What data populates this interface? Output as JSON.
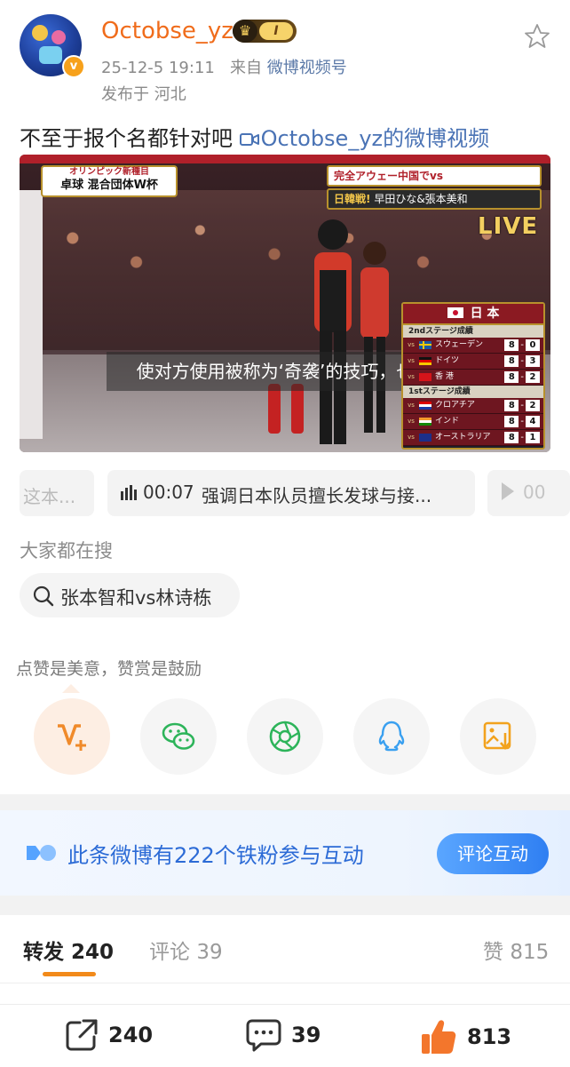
{
  "user": {
    "name": "Octobse_yz",
    "level": "I",
    "verified_mark": "v"
  },
  "post": {
    "date": "25-12-5 19:11",
    "from_label": "来自",
    "source": "微博视频号",
    "location": "发布于 河北",
    "text": "不至于报个名都针对吧 ",
    "video_link": "Octobse_yz的微博视频"
  },
  "video": {
    "tag_left_top": "オリンピック新種目",
    "tag_left_bottom": "卓球 混合団体W杯",
    "tag_right_top": "完全アウェー中国でvs",
    "tag_right_bottom_a": "日韓戦!",
    "tag_right_bottom_b": "早田ひな&張本美和",
    "live": "LIVE",
    "subtitle": "使对方使用被称为‘奇袭’的技巧，也",
    "scoreboard": {
      "team": "日 本",
      "stage2": "2ndステージ成績",
      "stage1": "1stステージ成績",
      "vs": "vs",
      "rows2": [
        {
          "name": "スウェーデン",
          "a": "8",
          "b": "0",
          "flag": "sweden"
        },
        {
          "name": "ドイツ",
          "a": "8",
          "b": "3",
          "flag": "germany"
        },
        {
          "name": "香 港",
          "a": "8",
          "b": "2",
          "flag": "hongkong"
        }
      ],
      "rows1": [
        {
          "name": "クロアチア",
          "a": "8",
          "b": "2",
          "flag": "croatia"
        },
        {
          "name": "インド",
          "a": "8",
          "b": "4",
          "flag": "india"
        },
        {
          "name": "オーストラリア",
          "a": "8",
          "b": "1",
          "flag": "australia"
        }
      ]
    }
  },
  "chapters": {
    "prev": "这本...",
    "current_time": "00:07",
    "current_title": "强调日本队员擅长发球与接...",
    "next_time": "00"
  },
  "search": {
    "title": "大家都在搜",
    "query": "张本智和vs林诗栋"
  },
  "reward": {
    "text": "点赞是美意，赞赏是鼓励",
    "buttons": [
      "reward-v-plus-icon",
      "wechat-icon",
      "moments-icon",
      "qq-icon",
      "save-image-icon"
    ]
  },
  "fans": {
    "text": "此条微博有222个铁粉参与互动",
    "button": "评论互动"
  },
  "tabs": {
    "repost_label": "转发",
    "repost_count": "240",
    "comment_label": "评论",
    "comment_count": "39",
    "like_label": "赞",
    "like_count": "815"
  },
  "bottom": {
    "repost": "240",
    "comment": "39",
    "like": "813"
  },
  "colors": {
    "accent": "#f06c1b",
    "link": "#4a73b5",
    "fans_blue": "#2c6bd6"
  }
}
